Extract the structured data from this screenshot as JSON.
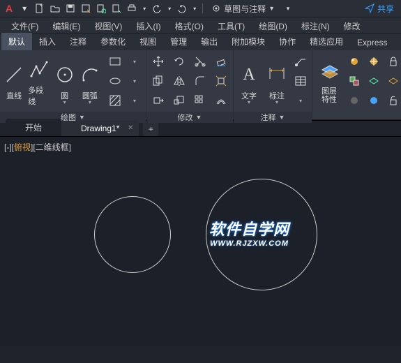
{
  "qat": {
    "logo": "A",
    "workspace_label": "草图与注释",
    "share_label": "共享"
  },
  "menubar": {
    "items": [
      {
        "label": "文件(F)"
      },
      {
        "label": "编辑(E)"
      },
      {
        "label": "视图(V)"
      },
      {
        "label": "插入(I)"
      },
      {
        "label": "格式(O)"
      },
      {
        "label": "工具(T)"
      },
      {
        "label": "绘图(D)"
      },
      {
        "label": "标注(N)"
      },
      {
        "label": "修改"
      }
    ]
  },
  "ribbon_tabs": {
    "items": [
      {
        "label": "默认",
        "active": true
      },
      {
        "label": "插入"
      },
      {
        "label": "注释"
      },
      {
        "label": "参数化"
      },
      {
        "label": "视图"
      },
      {
        "label": "管理"
      },
      {
        "label": "输出"
      },
      {
        "label": "附加模块"
      },
      {
        "label": "协作"
      },
      {
        "label": "精选应用"
      },
      {
        "label": "Express"
      }
    ]
  },
  "panels": {
    "draw": {
      "title": "绘图",
      "line": "直线",
      "polyline": "多段线",
      "circle": "圆",
      "arc": "圆弧"
    },
    "modify": {
      "title": "修改"
    },
    "annot": {
      "title": "注释",
      "text": "文字",
      "dim": "标注"
    },
    "layers": {
      "title": "图层\n特性"
    }
  },
  "doc_tabs": {
    "items": [
      {
        "label": "开始",
        "active": false
      },
      {
        "label": "Drawing1*",
        "active": true
      }
    ],
    "add": "+"
  },
  "viewport": {
    "prefix": "[-][",
    "mode": "俯视",
    "suffix": "][二维线框]"
  },
  "watermark": {
    "line1": "软件自学网",
    "line2": "WWW.RJZXW.COM"
  },
  "colors": {
    "accent_orange": "#e2a23a",
    "accent_blue": "#3aa0ff",
    "app_red": "#e83d3d"
  }
}
